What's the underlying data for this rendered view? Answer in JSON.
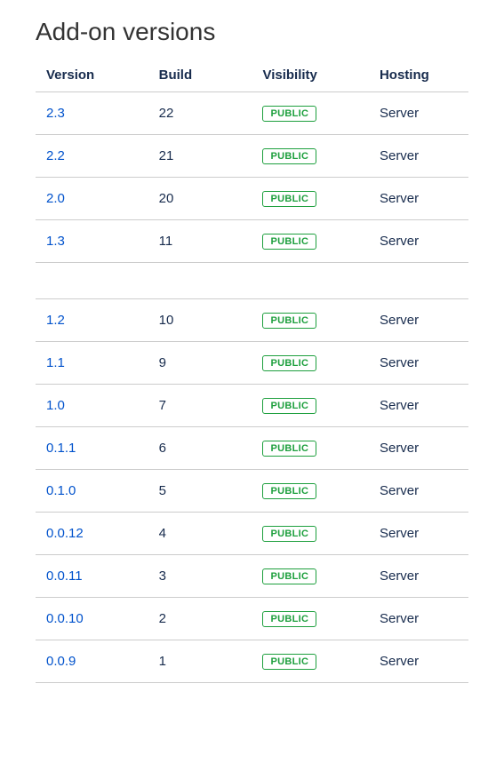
{
  "title": "Add-on versions",
  "table": {
    "headers": {
      "version": "Version",
      "build": "Build",
      "visibility": "Visibility",
      "hosting": "Hosting"
    },
    "visibility_label": "PUBLIC",
    "groups": [
      {
        "rows": [
          {
            "version": "2.3",
            "build": "22",
            "visibility": "PUBLIC",
            "hosting": "Server"
          },
          {
            "version": "2.2",
            "build": "21",
            "visibility": "PUBLIC",
            "hosting": "Server"
          },
          {
            "version": "2.0",
            "build": "20",
            "visibility": "PUBLIC",
            "hosting": "Server"
          },
          {
            "version": "1.3",
            "build": "11",
            "visibility": "PUBLIC",
            "hosting": "Server"
          }
        ]
      },
      {
        "rows": [
          {
            "version": "1.2",
            "build": "10",
            "visibility": "PUBLIC",
            "hosting": "Server"
          },
          {
            "version": "1.1",
            "build": "9",
            "visibility": "PUBLIC",
            "hosting": "Server"
          },
          {
            "version": "1.0",
            "build": "7",
            "visibility": "PUBLIC",
            "hosting": "Server"
          },
          {
            "version": "0.1.1",
            "build": "6",
            "visibility": "PUBLIC",
            "hosting": "Server"
          },
          {
            "version": "0.1.0",
            "build": "5",
            "visibility": "PUBLIC",
            "hosting": "Server"
          },
          {
            "version": "0.0.12",
            "build": "4",
            "visibility": "PUBLIC",
            "hosting": "Server"
          },
          {
            "version": "0.0.11",
            "build": "3",
            "visibility": "PUBLIC",
            "hosting": "Server"
          },
          {
            "version": "0.0.10",
            "build": "2",
            "visibility": "PUBLIC",
            "hosting": "Server"
          },
          {
            "version": "0.0.9",
            "build": "1",
            "visibility": "PUBLIC",
            "hosting": "Server"
          }
        ]
      }
    ]
  }
}
